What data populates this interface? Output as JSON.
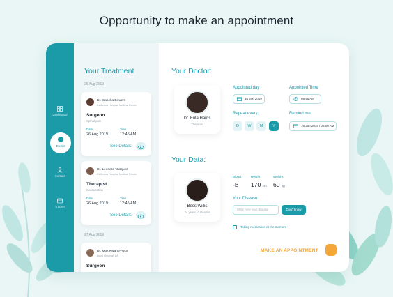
{
  "headline": "Opportunity to make an appointment",
  "sidebar": {
    "items": [
      {
        "label": "Dashboard",
        "icon": "grid-icon"
      },
      {
        "label": "Doctor",
        "icon": "doctor-icon",
        "active": true
      },
      {
        "label": "Contact",
        "icon": "contact-icon"
      },
      {
        "label": "Tracker",
        "icon": "tracker-icon"
      }
    ]
  },
  "treatment": {
    "title": "Your Treatment",
    "date_groups": [
      "26 Aug 2019",
      "27 Aug 2019"
    ],
    "cards": [
      {
        "doctor": "Dr. Isabella Bowers",
        "hospital": "California Hospital Medical Center",
        "role": "Surgeon",
        "condition": "Spinal pain",
        "date_label": "Date",
        "date": "26 Aug 2019",
        "time_label": "Time",
        "time": "12:45 AM",
        "action": "See Details"
      },
      {
        "doctor": "Dr. Leonard Vasquez",
        "hospital": "California Hospital Medical Center",
        "role": "Therapist",
        "condition": "Consultation",
        "date_label": "Date",
        "date": "26 Aug 2019",
        "time_label": "Time",
        "time": "12:45 AM",
        "action": "See Details"
      },
      {
        "doctor": "Dr. Mok Kwang-Hyun",
        "hospital": "Local Hospital, LA",
        "role": "Surgeon"
      }
    ]
  },
  "doctor": {
    "title": "Your Doctor:",
    "name": "Dr. Eula Harris",
    "specialty": "Therapist",
    "appointed_day_label": "Appointed day",
    "appointed_day": "16 Jan 2019",
    "appointed_time_label": "Appointed Time",
    "appointed_time": "08:45 AM",
    "repeat_label": "Repeat every:",
    "repeat_days": [
      "D",
      "W",
      "M",
      "Y"
    ],
    "repeat_selected": "Y",
    "remind_label": "Remind me:",
    "remind_value": "16 Jan 2019 / 08:00 AM"
  },
  "data": {
    "title": "Your Data:",
    "name": "Bess Willis",
    "sub": "24 years, California",
    "blood_label": "Blood",
    "blood": "-B",
    "height_label": "Height",
    "height": "170",
    "height_unit": "cm",
    "weight_label": "Weight",
    "weight": "60",
    "weight_unit": "kg",
    "disease_label": "Your Disease",
    "disease_placeholder": "Write here your disease",
    "dont_know": "Don't know",
    "medication_label": "Taking medication at the moment"
  },
  "cta": "MAKE AN APPOINTMENT",
  "colors": {
    "accent": "#1b9aa8",
    "cta": "#f4a63a",
    "background": "#e9f6f5"
  }
}
